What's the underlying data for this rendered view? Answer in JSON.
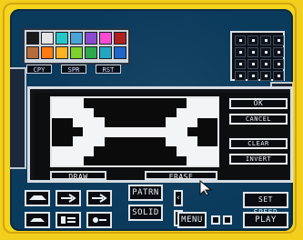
{
  "palette": {
    "swatches": [
      "#1a1a1a",
      "#e4e4e4",
      "#24c7c8",
      "#4aa3d6",
      "#8b4bd1",
      "#ff4bd2",
      "#b02020",
      "#b56b3a",
      "#ff7b12",
      "#ffb21f",
      "#7fd12b",
      "#2ea84b",
      "#23a7c1",
      "#1f66c9"
    ],
    "buttons": [
      "CPY",
      "SPR",
      "RST"
    ]
  },
  "dialog": {
    "buttons": {
      "ok": "OK",
      "cancel": "CANCEL",
      "clear": "CLEAR",
      "invert": "INVERT"
    },
    "modes": {
      "draw": "DRAW",
      "erase": "ERASE"
    }
  },
  "toolbar": {
    "pattern": "PATRN",
    "solid": "SOLID",
    "menu": "MENU",
    "set_speed": "SET SPEED",
    "play": "PLAY"
  },
  "colors": {
    "background": "#f2cf1c",
    "screen": "#0a3a5c",
    "dialog_border": "#d7dde2"
  }
}
